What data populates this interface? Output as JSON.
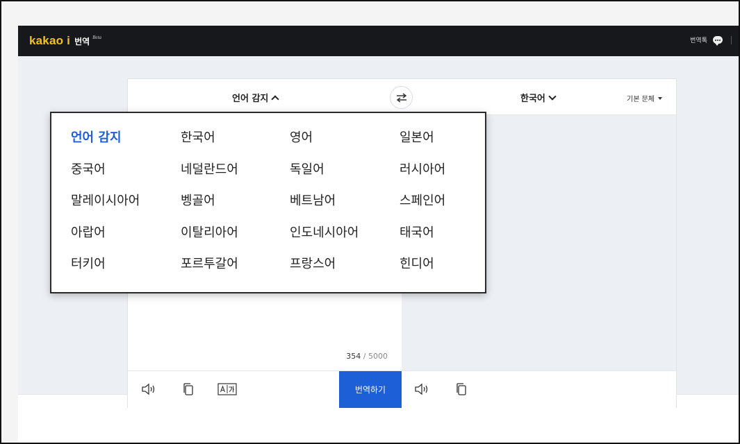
{
  "header": {
    "brand": "kakao i",
    "product": "번역",
    "beta": "Beta",
    "talk_link": "번역톡"
  },
  "translator": {
    "source_language": "언어 감지",
    "target_language": "한국어",
    "style_select": "기본 문체",
    "char_count_current": "354",
    "char_count_max": " / 5000",
    "translate_button": "번역하기"
  },
  "language_options": [
    "언어 감지",
    "한국어",
    "영어",
    "일본어",
    "중국어",
    "네덜란드어",
    "독일어",
    "러시아어",
    "말레이시아어",
    "벵골어",
    "베트남어",
    "스페인어",
    "아랍어",
    "이탈리아어",
    "인도네시아어",
    "태국어",
    "터키어",
    "포르투갈어",
    "프랑스어",
    "힌디어"
  ],
  "selected_language": "언어 감지",
  "colors": {
    "brand_yellow": "#f3c21b",
    "accent_blue": "#1d5fd6",
    "topbar": "#17181c"
  },
  "icons": {
    "swap": "swap-arrows-icon",
    "speaker": "speaker-icon",
    "copy": "copy-icon",
    "dictionary": "font-translate-icon",
    "talk": "speech-bubble-icon"
  }
}
